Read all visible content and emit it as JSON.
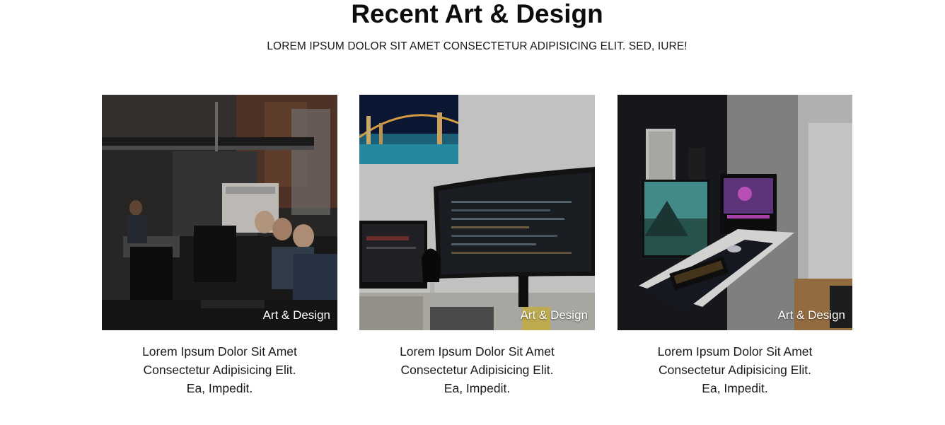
{
  "section": {
    "title": "Recent Art & Design",
    "subtitle": "LOREM IPSUM DOLOR SIT AMET CONSECTETUR ADIPISICING ELIT. SED, IURE!"
  },
  "cards": [
    {
      "image": "office-workspace-photo",
      "tag": "Art & Design",
      "caption": [
        "Lorem Ipsum Dolor Sit Amet",
        "Consectetur Adipisicing Elit.",
        "Ea, Impedit."
      ]
    },
    {
      "image": "coding-desk-setup-photo",
      "tag": "Art & Design",
      "caption": [
        "Lorem Ipsum Dolor Sit Amet",
        "Consectetur Adipisicing Elit.",
        "Ea, Impedit."
      ]
    },
    {
      "image": "gaming-desk-setup-photo",
      "tag": "Art & Design",
      "caption": [
        "Lorem Ipsum Dolor Sit Amet",
        "Consectetur Adipisicing Elit.",
        "Ea, Impedit."
      ]
    }
  ]
}
